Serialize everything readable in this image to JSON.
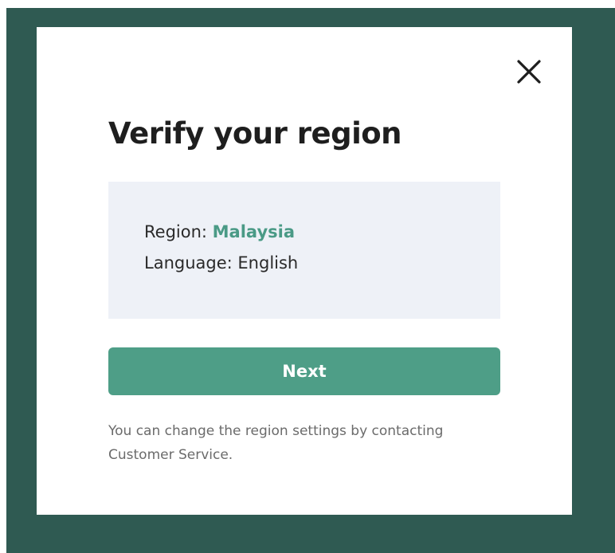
{
  "modal": {
    "title": "Verify your region",
    "close_icon": "close-icon",
    "info": {
      "region_label": "Region:",
      "region_value": "Malaysia",
      "language_label": "Language:",
      "language_value": "English"
    },
    "next_label": "Next",
    "helper_text": "You can change the region settings by contacting Customer Service."
  },
  "colors": {
    "backdrop": "#2f5a52",
    "accent": "#4e9e87",
    "region_value": "#4a9a86",
    "info_box": "#eef1f7"
  }
}
